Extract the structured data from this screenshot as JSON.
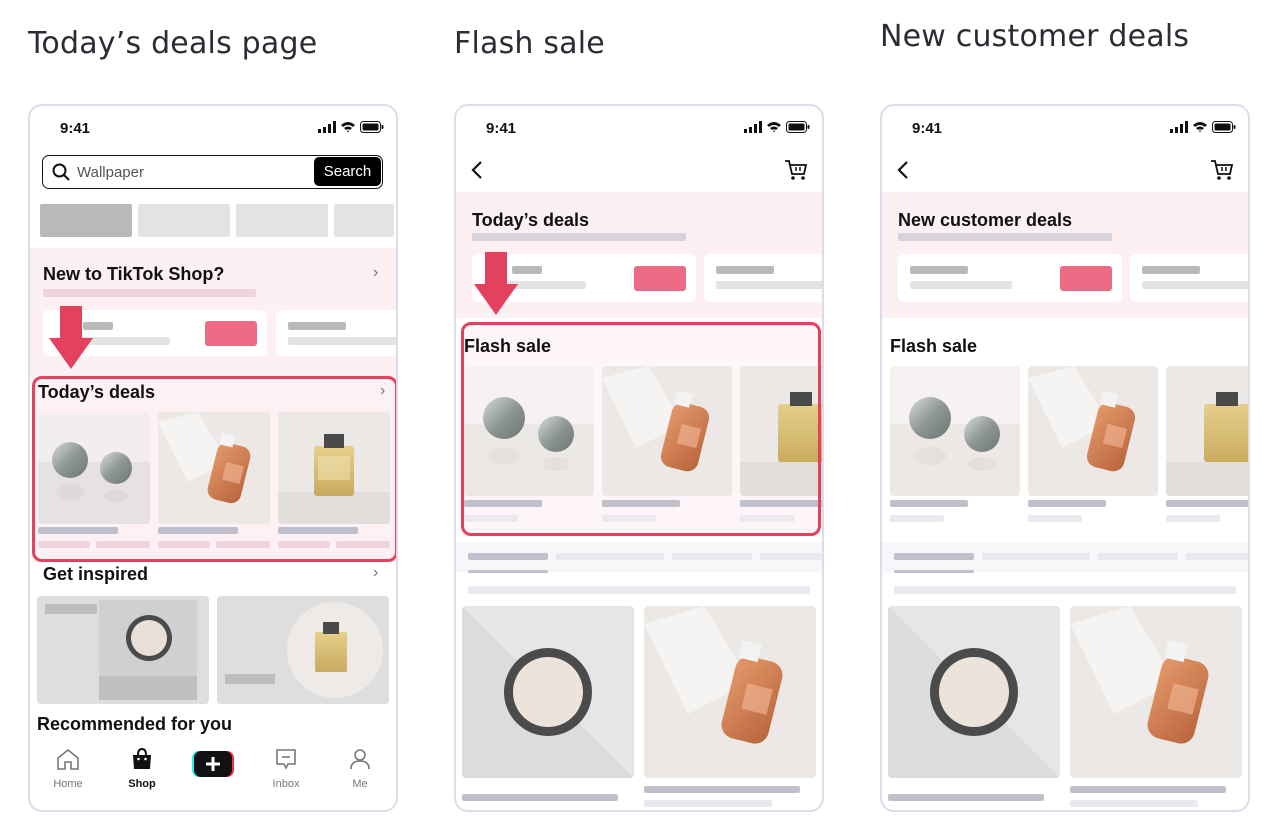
{
  "titles": {
    "col1": "Today’s deals page",
    "col2": "Flash sale",
    "col3": "New customer deals"
  },
  "status_time": "9:41",
  "phone1": {
    "search_placeholder": "Wallpaper",
    "search_button": "Search",
    "new_to_shop": "New to TikTok Shop?",
    "todays_deals": "Today’s deals",
    "get_inspired": "Get inspired",
    "recommended": "Recommended for you",
    "nav": {
      "home": "Home",
      "shop": "Shop",
      "inbox": "Inbox",
      "me": "Me"
    }
  },
  "phone2": {
    "header": "Today’s deals",
    "flash_sale": "Flash sale"
  },
  "phone3": {
    "header": "New customer deals",
    "flash_sale": "Flash sale"
  },
  "colors": {
    "highlight": "#e3425f",
    "pink_bg": "#fcf0f3",
    "deal_button": "#ec6c86"
  }
}
